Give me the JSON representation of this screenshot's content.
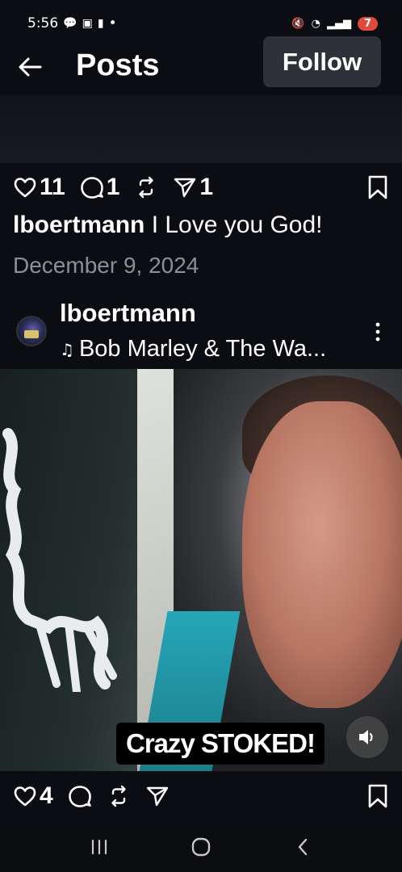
{
  "status_bar": {
    "time": "5:56",
    "dot": "•",
    "battery": "7"
  },
  "header": {
    "title": "Posts",
    "follow_label": "Follow"
  },
  "post": {
    "likes": "11",
    "comments": "1",
    "shares": "1",
    "caption_user": "lboertmann",
    "caption_text": "I Love you God!",
    "date": "December 9, 2024"
  },
  "reel": {
    "author": "lboertmann",
    "music": "Bob Marley & The Wa...",
    "sticker_text": "Crazy STOKED!",
    "likes": "4"
  },
  "icons": {
    "back": "arrow-left-icon",
    "heart": "heart-icon",
    "comment": "comment-icon",
    "repost": "repost-icon",
    "share": "send-icon",
    "bookmark": "bookmark-icon",
    "more": "more-vertical-icon",
    "sound": "speaker-icon",
    "music": "music-note-icon"
  }
}
